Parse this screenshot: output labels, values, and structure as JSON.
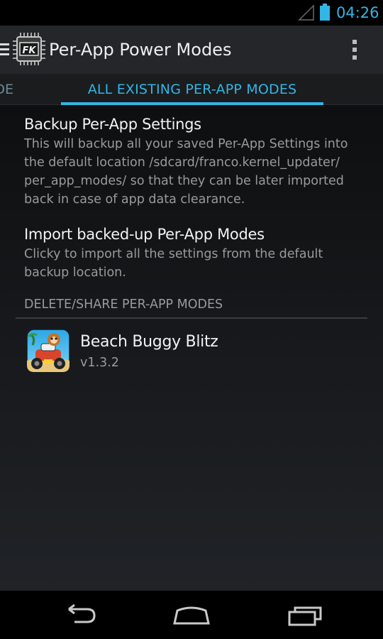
{
  "status_bar": {
    "time": "04:26",
    "signal_icon": "signal-empty-icon",
    "battery_icon": "battery-full-icon",
    "accent_color": "#33b5e5"
  },
  "action_bar": {
    "title": "Per-App Power Modes",
    "logo_text": "FK",
    "drawer_icon": "drawer-menu-icon",
    "overflow_icon": "overflow-menu-icon"
  },
  "tabs": {
    "previous_partial": "DE",
    "active": "ALL EXISTING PER-APP MODES"
  },
  "preferences": {
    "backup": {
      "title": "Backup Per-App Settings",
      "summary": "This will backup all your saved Per-App Settings into the default location /sdcard/franco.kernel_updater/ per_app_modes/ so that they can be later imported back in case of app data clearance."
    },
    "import": {
      "title": "Import backed-up Per-App Modes",
      "summary": "Clicky to import all the settings from the default backup location."
    }
  },
  "category": {
    "header": "DELETE/SHARE PER-APP MODES"
  },
  "apps": [
    {
      "name": "Beach Buggy Blitz",
      "version": "v1.3.2",
      "icon": "beach-buggy-blitz-icon"
    }
  ],
  "nav_bar": {
    "back_icon": "back-icon",
    "home_icon": "home-icon",
    "recents_icon": "recents-icon"
  }
}
